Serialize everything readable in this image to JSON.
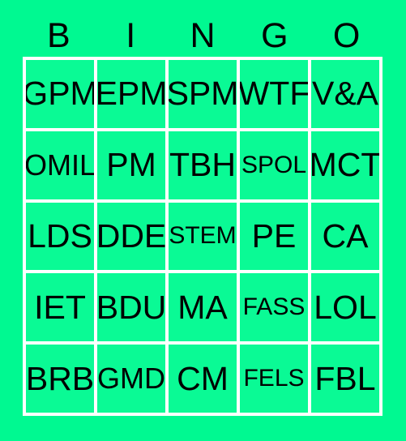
{
  "card": {
    "type": "bingo-card",
    "background_color": "#00f991",
    "cell_color": "#0afa95",
    "grid_line_color": "#ffffff",
    "text_color": "#000000",
    "header": {
      "letters": [
        "B",
        "I",
        "N",
        "G",
        "O"
      ]
    },
    "columns": [
      "B",
      "I",
      "N",
      "G",
      "O"
    ],
    "rows": [
      {
        "cells": [
          {
            "label": "GPM",
            "size": "lg"
          },
          {
            "label": "EPM",
            "size": "lg"
          },
          {
            "label": "SPM",
            "size": "lg"
          },
          {
            "label": "WTF",
            "size": "lg"
          },
          {
            "label": "V&A",
            "size": "lg"
          }
        ]
      },
      {
        "cells": [
          {
            "label": "OMIL",
            "size": "md"
          },
          {
            "label": "PM",
            "size": "lg"
          },
          {
            "label": "TBH",
            "size": "lg"
          },
          {
            "label": "SPOL",
            "size": "sm"
          },
          {
            "label": "MCT",
            "size": "lg"
          }
        ]
      },
      {
        "cells": [
          {
            "label": "LDS",
            "size": "lg"
          },
          {
            "label": "DDE",
            "size": "lg"
          },
          {
            "label": "STEM",
            "size": "sm"
          },
          {
            "label": "PE",
            "size": "lg"
          },
          {
            "label": "CA",
            "size": "lg"
          }
        ]
      },
      {
        "cells": [
          {
            "label": "IET",
            "size": "lg"
          },
          {
            "label": "BDU",
            "size": "lg"
          },
          {
            "label": "MA",
            "size": "lg"
          },
          {
            "label": "FASS",
            "size": "sm"
          },
          {
            "label": "LOL",
            "size": "lg"
          }
        ]
      },
      {
        "cells": [
          {
            "label": "BRB",
            "size": "lg"
          },
          {
            "label": "GMD",
            "size": "md"
          },
          {
            "label": "CM",
            "size": "lg"
          },
          {
            "label": "FELS",
            "size": "sm"
          },
          {
            "label": "FBL",
            "size": "lg"
          }
        ]
      }
    ]
  }
}
